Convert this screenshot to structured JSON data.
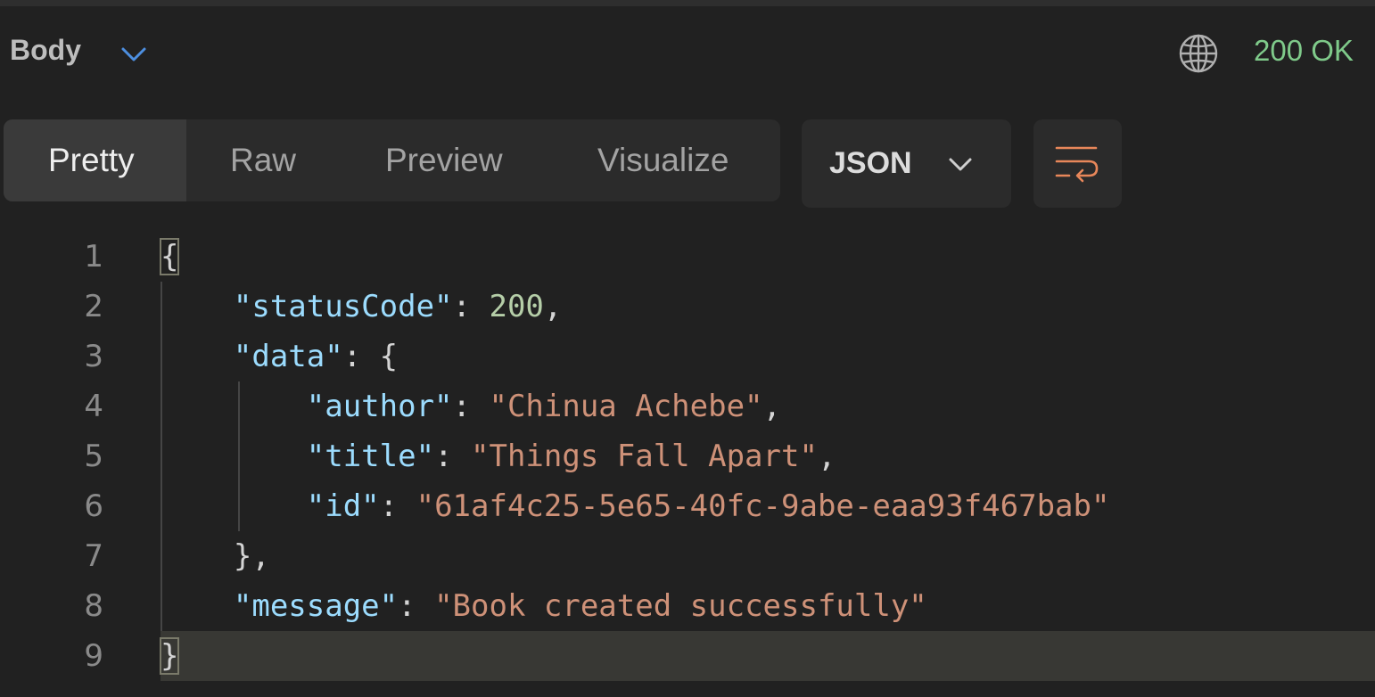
{
  "header": {
    "section_label": "Body",
    "status": "200 OK"
  },
  "tabs": [
    {
      "label": "Pretty",
      "active": true
    },
    {
      "label": "Raw",
      "active": false
    },
    {
      "label": "Preview",
      "active": false
    },
    {
      "label": "Visualize",
      "active": false
    }
  ],
  "format": {
    "selected": "JSON"
  },
  "icons": {
    "section_dropdown": "chevron-down-icon",
    "network": "globe-icon",
    "format_dropdown": "chevron-down-icon",
    "wrap": "wrap-lines-icon"
  },
  "colors": {
    "status_ok": "#7fca8a",
    "wrap_icon": "#e8875a",
    "chevron_accent": "#4d8fe0",
    "json_key": "#9cdcfe",
    "json_string": "#ce9178",
    "json_number": "#b5cea8"
  },
  "editor": {
    "current_line": 9,
    "lines": [
      {
        "num": "1",
        "tokens": [
          {
            "t": "p",
            "v": "{"
          }
        ]
      },
      {
        "num": "2",
        "tokens": [
          {
            "t": "p",
            "v": "    "
          },
          {
            "t": "k",
            "v": "\"statusCode\""
          },
          {
            "t": "p",
            "v": ": "
          },
          {
            "t": "n",
            "v": "200"
          },
          {
            "t": "p",
            "v": ","
          }
        ]
      },
      {
        "num": "3",
        "tokens": [
          {
            "t": "p",
            "v": "    "
          },
          {
            "t": "k",
            "v": "\"data\""
          },
          {
            "t": "p",
            "v": ": {"
          }
        ]
      },
      {
        "num": "4",
        "tokens": [
          {
            "t": "p",
            "v": "        "
          },
          {
            "t": "k",
            "v": "\"author\""
          },
          {
            "t": "p",
            "v": ": "
          },
          {
            "t": "s",
            "v": "\"Chinua Achebe\""
          },
          {
            "t": "p",
            "v": ","
          }
        ]
      },
      {
        "num": "5",
        "tokens": [
          {
            "t": "p",
            "v": "        "
          },
          {
            "t": "k",
            "v": "\"title\""
          },
          {
            "t": "p",
            "v": ": "
          },
          {
            "t": "s",
            "v": "\"Things Fall Apart\""
          },
          {
            "t": "p",
            "v": ","
          }
        ]
      },
      {
        "num": "6",
        "tokens": [
          {
            "t": "p",
            "v": "        "
          },
          {
            "t": "k",
            "v": "\"id\""
          },
          {
            "t": "p",
            "v": ": "
          },
          {
            "t": "s",
            "v": "\"61af4c25-5e65-40fc-9abe-eaa93f467bab\""
          }
        ]
      },
      {
        "num": "7",
        "tokens": [
          {
            "t": "p",
            "v": "    },"
          }
        ]
      },
      {
        "num": "8",
        "tokens": [
          {
            "t": "p",
            "v": "    "
          },
          {
            "t": "k",
            "v": "\"message\""
          },
          {
            "t": "p",
            "v": ": "
          },
          {
            "t": "s",
            "v": "\"Book created successfully\""
          }
        ]
      },
      {
        "num": "9",
        "tokens": [
          {
            "t": "p",
            "v": "}"
          }
        ]
      }
    ]
  }
}
